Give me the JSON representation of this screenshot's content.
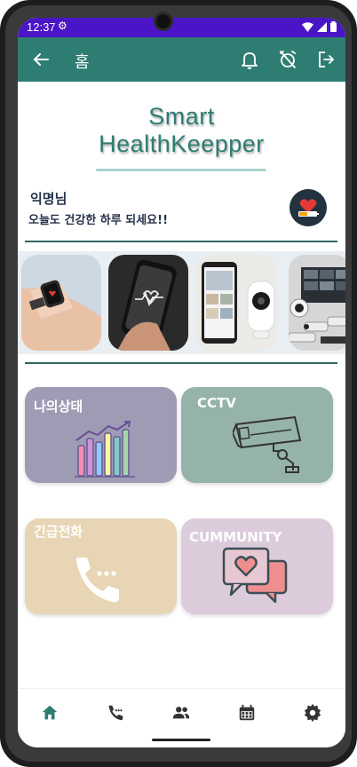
{
  "status_bar": {
    "time": "12:37"
  },
  "app_bar": {
    "title": "홈"
  },
  "brand": {
    "line1": "Smart",
    "line2": "HealthKeepper"
  },
  "user": {
    "name": "익명님",
    "greeting": "오늘도 건강한 하루 되세요!!"
  },
  "carousel": {
    "slides": [
      "smartwatch-heart-rate",
      "phone-heartbeat",
      "phone-home-camera",
      "cctv-monitors"
    ]
  },
  "tiles": {
    "my_status": "나의상태",
    "cctv": "CCTV",
    "emergency_call": "긴급전화",
    "community": "CUMMUNITY"
  },
  "bottom_nav": {
    "items": [
      "home-icon",
      "phone-call-icon",
      "people-icon",
      "calendar-icon",
      "settings-icon"
    ]
  },
  "colors": {
    "status_bar": "#4a15c7",
    "app_bar": "#2e7d72",
    "tile_status": "#9e9bb5",
    "tile_cctv": "#95b3ab",
    "tile_emergency": "#e8d5b5",
    "tile_community": "#dccbdb"
  }
}
